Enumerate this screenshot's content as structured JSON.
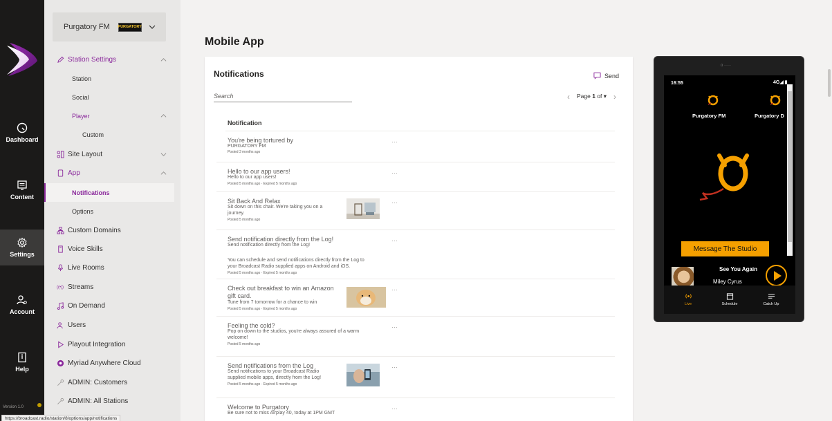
{
  "rail": {
    "items": [
      {
        "label": "Dashboard"
      },
      {
        "label": "Content"
      },
      {
        "label": "Settings"
      },
      {
        "label": "Account"
      },
      {
        "label": "Help"
      }
    ],
    "version": "Version 1.0"
  },
  "sidebar": {
    "station_name": "Purgatory FM",
    "station_badge": "PURGATORY",
    "items": [
      {
        "label": "Station Settings"
      },
      {
        "label": "Station"
      },
      {
        "label": "Social"
      },
      {
        "label": "Player"
      },
      {
        "label": "Custom"
      },
      {
        "label": "Site Layout"
      },
      {
        "label": "App"
      },
      {
        "label": "Notifications"
      },
      {
        "label": "Options"
      },
      {
        "label": "Custom Domains"
      },
      {
        "label": "Voice Skills"
      },
      {
        "label": "Live Rooms"
      },
      {
        "label": "Streams"
      },
      {
        "label": "On Demand"
      },
      {
        "label": "Users"
      },
      {
        "label": "Playout Integration"
      },
      {
        "label": "Myriad Anywhere Cloud"
      },
      {
        "label": "ADMIN: Customers"
      },
      {
        "label": "ADMIN: All Stations"
      }
    ]
  },
  "status_url": "https://broadcast.radio/station/8/options/app/notifications",
  "main": {
    "title": "Mobile App",
    "card_title": "Notifications",
    "send_label": "Send",
    "search_placeholder": "Search",
    "pager": {
      "prefix": "Page ",
      "page": "1",
      "suffix": " of ▾"
    },
    "column_header": "Notification",
    "rows": [
      {
        "title": "You're being tortured by",
        "body": [
          "PURGATORY FM"
        ],
        "meta": "Posted 3 months ago",
        "dots": "···"
      },
      {
        "title": "Hello to our app users!",
        "body": [
          "Hello to our app users!"
        ],
        "meta": "Posted 5 months ago  ·  Expired 5 months ago",
        "dots": "···"
      },
      {
        "title": "Sit Back And Relax",
        "body": [
          "Sit down on this chair. We're taking you on a",
          "journey."
        ],
        "meta": "Posted 5 months ago",
        "dots": "···"
      },
      {
        "title": "Send notification directly from the Log!",
        "body": [
          "Send notification directly from the Log!",
          "",
          "You can schedule and send notifications directly from the Log to",
          "your Broadcast Radio supplied apps on Android and iOS."
        ],
        "meta": "Posted 5 months ago  ·  Expired 5 months ago",
        "dots": "···"
      },
      {
        "title": "Check out breakfast to win an Amazon",
        "title2": "gift card.",
        "body": [
          "Tune from 7 tomorrow for a chance to win"
        ],
        "meta": "Posted 5 months ago  ·  Expired 5 months ago",
        "dots": "···"
      },
      {
        "title": "Feeling the cold?",
        "body": [
          "Pop on down to the studios, you're always assured of a warm",
          "welcome!"
        ],
        "meta": "Posted 5 months ago",
        "dots": "···"
      },
      {
        "title": "Send notifications from the Log",
        "body": [
          "Send notifications to your Broadcast Radio",
          "supplied mobile apps, directly from the Log!"
        ],
        "meta": "Posted 5 months ago  ·  Expired 5 months ago",
        "dots": "···"
      },
      {
        "title": "Welcome to Purgatory",
        "body": [
          "Be sure not to miss Airplay 40, today at 1PM GMT"
        ],
        "meta": "",
        "dots": "···"
      }
    ]
  },
  "phone": {
    "camera": "o ·····",
    "time": "16:55",
    "signal": "4G◢ ▮",
    "station1": "Purgatory FM",
    "station2": "Purgatory D",
    "message_button": "Message The Studio",
    "song": "See You Again",
    "artist": "Miley Cyrus",
    "tabs": [
      {
        "label": "Live"
      },
      {
        "label": "Schedule"
      },
      {
        "label": "Catch Up"
      }
    ]
  },
  "colors": {
    "accent": "#8b2a9c",
    "phone_accent": "#f5a000"
  }
}
